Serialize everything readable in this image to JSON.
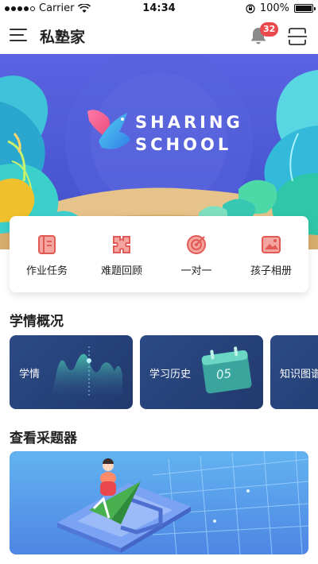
{
  "status_bar": {
    "carrier": "Carrier",
    "time": "14:34",
    "battery": "100%"
  },
  "nav": {
    "title": "私塾家",
    "notification_count": "32"
  },
  "banner": {
    "line1": "SHARING",
    "line2": "SCHOOL"
  },
  "quick_actions": [
    {
      "label": "作业任务",
      "icon": "homework-book-icon"
    },
    {
      "label": "难题回顾",
      "icon": "puzzle-icon"
    },
    {
      "label": "一对一",
      "icon": "target-icon"
    },
    {
      "label": "孩子相册",
      "icon": "photo-album-icon"
    }
  ],
  "overview": {
    "title": "学情概况",
    "cards": [
      {
        "label": "学情",
        "icon": "area-chart-icon"
      },
      {
        "label": "学习历史",
        "icon": "calendar-icon",
        "calendar_day": "05"
      },
      {
        "label": "知识图谱",
        "icon": "knowledge-map-icon"
      }
    ]
  },
  "quiz_section": {
    "title": "查看采题器"
  },
  "colors": {
    "accent": "#e9484c",
    "card_navy": "#2c4a85",
    "banner_blue": "#4b5bd6"
  }
}
